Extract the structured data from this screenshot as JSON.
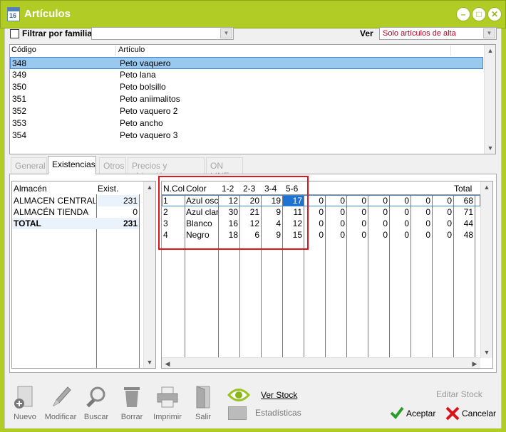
{
  "window": {
    "title": "Artículos",
    "icon": "calendar-app-icon",
    "icon_text": "16"
  },
  "filter": {
    "family_label": "Filtrar por familia",
    "family_value": "",
    "ver_label": "Ver",
    "ver_value": "Solo artículos de alta"
  },
  "articles": {
    "headers": [
      "Código",
      "Artículo"
    ],
    "rows": [
      [
        "348",
        "Peto vaquero"
      ],
      [
        "349",
        "Peto lana"
      ],
      [
        "350",
        "Peto bolsillo"
      ],
      [
        "351",
        "Peto aniimalitos"
      ],
      [
        "352",
        "Peto vaquero 2"
      ],
      [
        "353",
        "Peto ancho"
      ],
      [
        "354",
        "Peto vaquero 3"
      ]
    ],
    "selected_index": 0
  },
  "tabs": [
    {
      "label": "General",
      "active": false
    },
    {
      "label": "Existencias",
      "active": true
    },
    {
      "label": "Otros",
      "active": false
    },
    {
      "label": "Precios y ubicación",
      "active": false
    },
    {
      "label": "ON LINE",
      "active": false
    }
  ],
  "stock": {
    "headers": [
      "Almacén",
      "Exist."
    ],
    "rows": [
      [
        "ALMACEN CENTRAL",
        "231"
      ],
      [
        "ALMACÉN TIENDA",
        "0"
      ],
      [
        "TOTAL",
        "231"
      ]
    ]
  },
  "sizes": {
    "headers": [
      "N.Col",
      "Color",
      "1-2",
      "2-3",
      "3-4",
      "5-6",
      "",
      "",
      "",
      "",
      "",
      "",
      "",
      "Total"
    ],
    "rows": [
      [
        "1",
        "Azul oscuro",
        "12",
        "20",
        "19",
        "17",
        "0",
        "0",
        "0",
        "0",
        "0",
        "0",
        "0",
        "68"
      ],
      [
        "2",
        "Azul claro",
        "30",
        "21",
        "9",
        "11",
        "0",
        "0",
        "0",
        "0",
        "0",
        "0",
        "0",
        "71"
      ],
      [
        "3",
        "Blanco",
        "16",
        "12",
        "4",
        "12",
        "0",
        "0",
        "0",
        "0",
        "0",
        "0",
        "0",
        "44"
      ],
      [
        "4",
        "Negro",
        "18",
        "6",
        "9",
        "15",
        "0",
        "0",
        "0",
        "0",
        "0",
        "0",
        "0",
        "48"
      ]
    ]
  },
  "toolbar": {
    "nuevo": "Nuevo",
    "modificar": "Modificar",
    "buscar": "Buscar",
    "borrar": "Borrar",
    "imprimir": "Imprimir",
    "salir": "Salir",
    "ver_stock": "Ver Stock",
    "estadisticas": "Estadísticas",
    "editar_stock": "Editar Stock",
    "aceptar": "Aceptar",
    "cancelar": "Cancelar"
  },
  "colors": {
    "accent": "#b2cc26",
    "selection": "#99c9ef",
    "highlight_cell": "#1e73d2",
    "annotation": "#e2141b"
  }
}
